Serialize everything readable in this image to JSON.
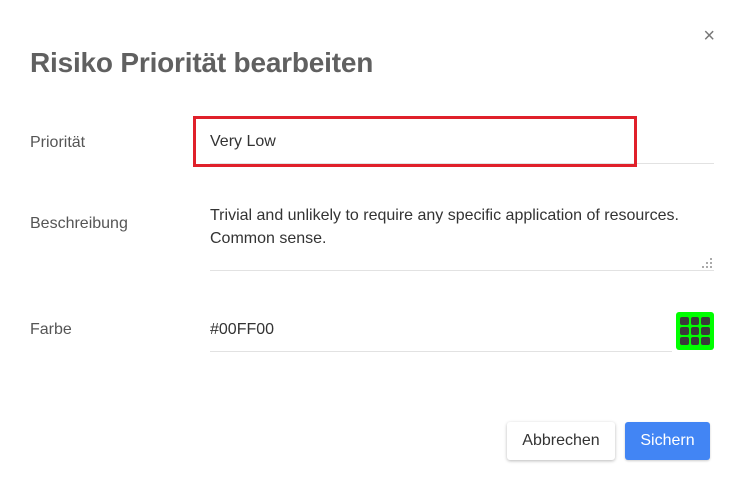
{
  "dialog": {
    "title": "Risiko Priorität bearbeiten",
    "close_icon": "close-icon",
    "close_glyph": "×"
  },
  "form": {
    "priority": {
      "label": "Priorität",
      "value": "Very Low"
    },
    "description": {
      "label": "Beschreibung",
      "value": "Trivial and unlikely to require any specific application of resources. Common sense."
    },
    "color": {
      "label": "Farbe",
      "value": "#00FF00",
      "picker_icon": "color-palette-grid-icon"
    }
  },
  "buttons": {
    "cancel_label": "Abbrechen",
    "save_label": "Sichern"
  },
  "colors": {
    "accent": "#4285f4",
    "highlight_border": "#e0202a",
    "swatch": "#00ff00"
  }
}
